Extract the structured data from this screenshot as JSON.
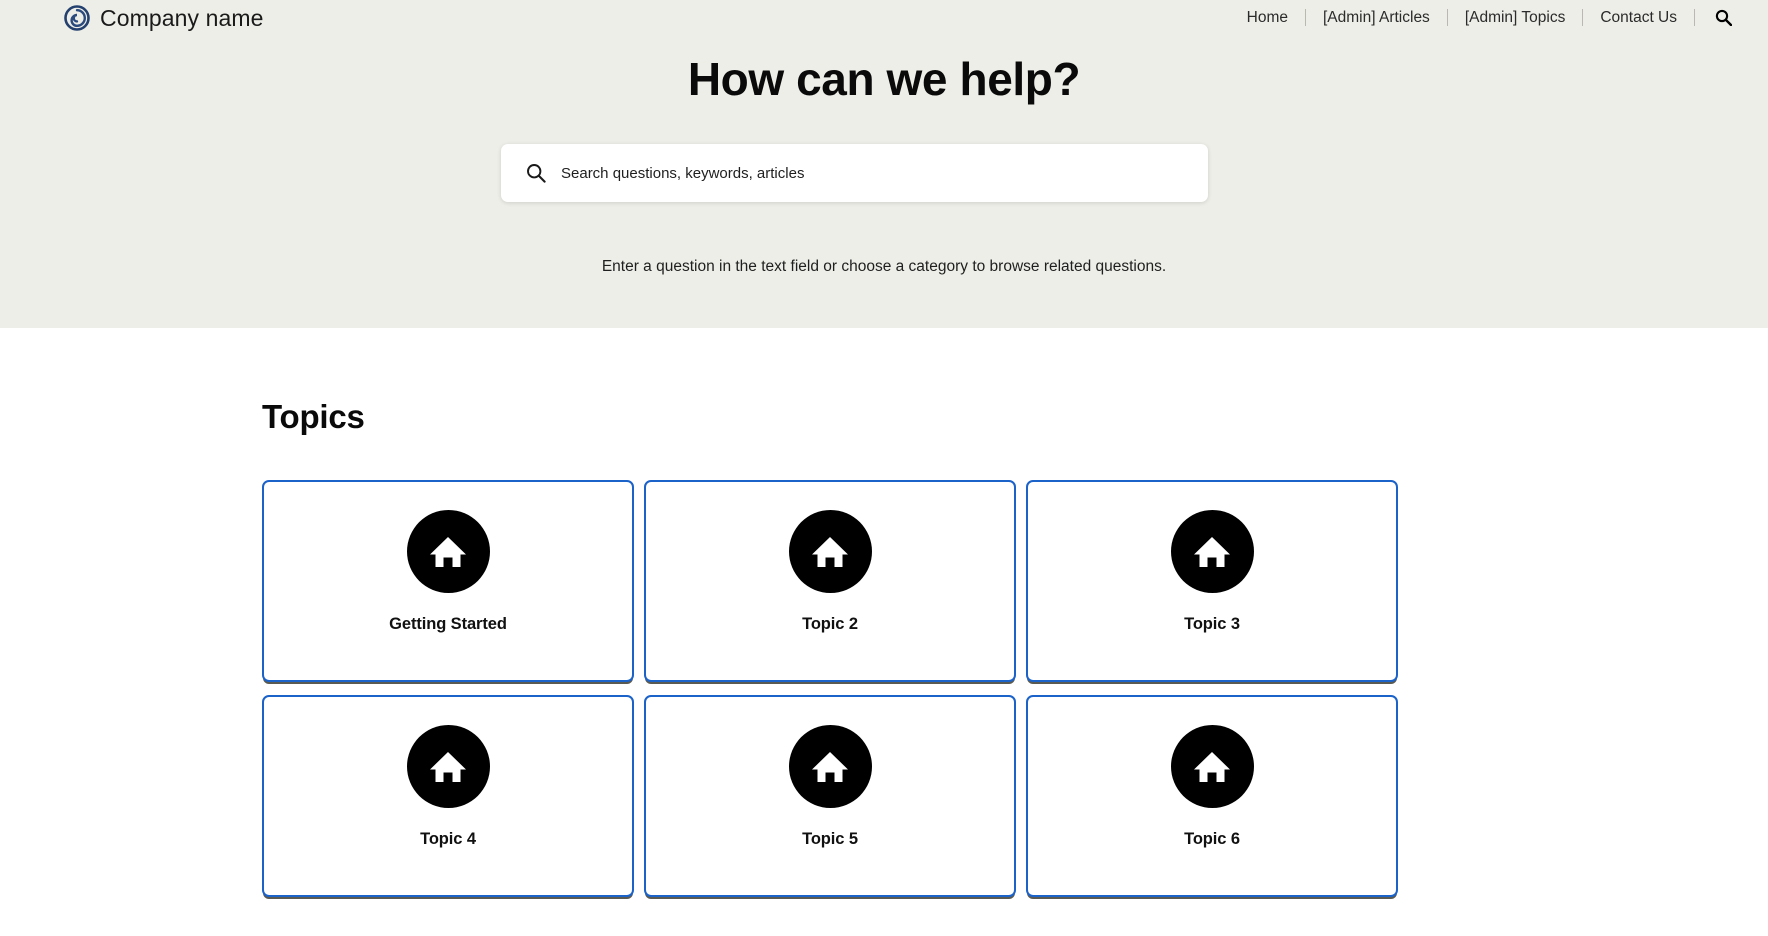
{
  "header": {
    "brand_name": "Company name",
    "brand_logo_icon": "spiral-circle-logo",
    "brand_logo_color": "#1f3864",
    "nav": [
      {
        "label": "Home"
      },
      {
        "label": "[Admin] Articles"
      },
      {
        "label": "[Admin] Topics"
      },
      {
        "label": "Contact Us"
      }
    ],
    "search_icon": "search-icon"
  },
  "hero": {
    "title": "How can we help?",
    "background_color": "#eeeee8",
    "search": {
      "icon": "search-icon",
      "placeholder": "Search questions, keywords, articles",
      "value": ""
    },
    "subtitle": "Enter a question in the text field or choose a category to browse related questions."
  },
  "topics": {
    "heading": "Topics",
    "card_border_color": "#1b62c9",
    "card_icon_background": "#000000",
    "cards": [
      {
        "label": "Getting Started",
        "icon": "home-icon"
      },
      {
        "label": "Topic 2",
        "icon": "home-icon"
      },
      {
        "label": "Topic 3",
        "icon": "home-icon"
      },
      {
        "label": "Topic 4",
        "icon": "home-icon"
      },
      {
        "label": "Topic 5",
        "icon": "home-icon"
      },
      {
        "label": "Topic 6",
        "icon": "home-icon"
      }
    ]
  }
}
